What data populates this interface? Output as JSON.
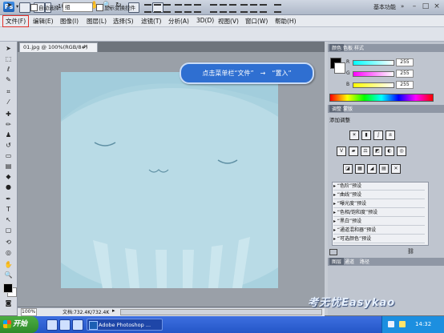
{
  "app": {
    "logo": "Ps",
    "zoom": "100%",
    "workspace": "基本功能",
    "icons": [
      "br-icon",
      "mb-icon",
      "zoom-dropdown",
      "hand-icon",
      "zoom-icon",
      "rotate-icon",
      "grid-icon",
      "screen-mode-icon"
    ]
  },
  "menubar": {
    "items": [
      "文件(F)",
      "编辑(E)",
      "图像(I)",
      "图层(L)",
      "选择(S)",
      "滤镜(T)",
      "分析(A)",
      "3D(D)",
      "视图(V)",
      "窗口(W)",
      "帮助(H)"
    ]
  },
  "options": {
    "auto_select_label": "自动选择:",
    "auto_select_value": "组",
    "transform_label": "显示变换控件"
  },
  "document": {
    "tab_title": "01.jpg @ 100%(RGB/8#)",
    "close": "×",
    "zoom_status": "100%",
    "doc_size": "文档:732.4K/732.4K"
  },
  "tooltip": "点击菜单栏“文件”　→　“置入”",
  "color_panel": {
    "tabs": [
      "颜色",
      "色板",
      "样式"
    ],
    "channels": [
      {
        "label": "R",
        "value": "255"
      },
      {
        "label": "G",
        "value": "255"
      },
      {
        "label": "B",
        "value": "255"
      }
    ]
  },
  "adjust_panel": {
    "tabs": [
      "调整",
      "蒙版"
    ],
    "heading": "添加调整",
    "presets": [
      "“色阶”预设",
      "“曲线”预设",
      "“曝光度”预设",
      "“色相/饱和度”预设",
      "“黑白”预设",
      "“通道混和器”预设",
      "“可选颜色”预设"
    ]
  },
  "layers_panel": {
    "tabs": [
      "图层",
      "通道",
      "路径"
    ]
  },
  "watermark": "考无忧Easykao",
  "taskbar": {
    "start": "开始",
    "task": "Adobe Photoshop ...",
    "time": "14:32"
  },
  "colors": {
    "canvas": "#a7cfdc",
    "tooltip": "#2f6fd1",
    "highlight": "#e0302a"
  }
}
